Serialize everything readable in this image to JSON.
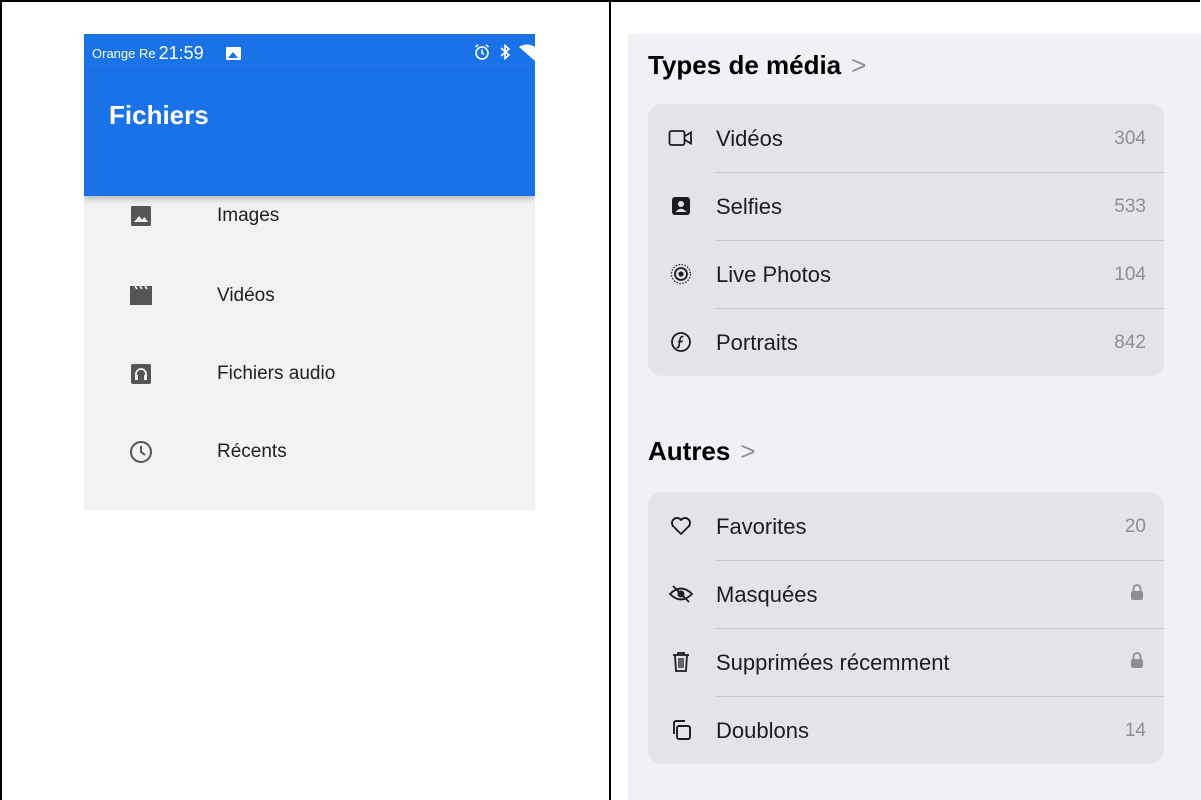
{
  "android": {
    "status": {
      "carrier": "Orange Re",
      "time": "21:59"
    },
    "title": "Fichiers",
    "items": [
      {
        "label": "Images",
        "icon": "image-icon"
      },
      {
        "label": "Vidéos",
        "icon": "video-clapper-icon"
      },
      {
        "label": "Fichiers audio",
        "icon": "headphones-icon"
      },
      {
        "label": "Récents",
        "icon": "clock-icon"
      }
    ],
    "colors": {
      "accent": "#1a72e8",
      "background": "#f2f2f2"
    }
  },
  "ios": {
    "media_types": {
      "title": "Types de média",
      "chevron": ">",
      "items": [
        {
          "label": "Vidéos",
          "count": "304",
          "icon": "video-camera-icon"
        },
        {
          "label": "Selfies",
          "count": "533",
          "icon": "selfie-portrait-icon"
        },
        {
          "label": "Live Photos",
          "count": "104",
          "icon": "live-photo-icon"
        },
        {
          "label": "Portraits",
          "count": "842",
          "icon": "portrait-aperture-icon"
        }
      ]
    },
    "others": {
      "title": "Autres",
      "chevron": ">",
      "items": [
        {
          "label": "Favorites",
          "count": "20",
          "icon": "heart-icon"
        },
        {
          "label": "Masquées",
          "count": "",
          "icon": "eye-slash-icon",
          "locked": true
        },
        {
          "label": "Supprimées récemment",
          "count": "",
          "icon": "trash-icon",
          "locked": true
        },
        {
          "label": "Doublons",
          "count": "14",
          "icon": "duplicate-icon"
        }
      ]
    },
    "colors": {
      "background": "#f1f1f5",
      "card": "#e4e3e9",
      "secondary_text": "#8e8e93"
    }
  }
}
